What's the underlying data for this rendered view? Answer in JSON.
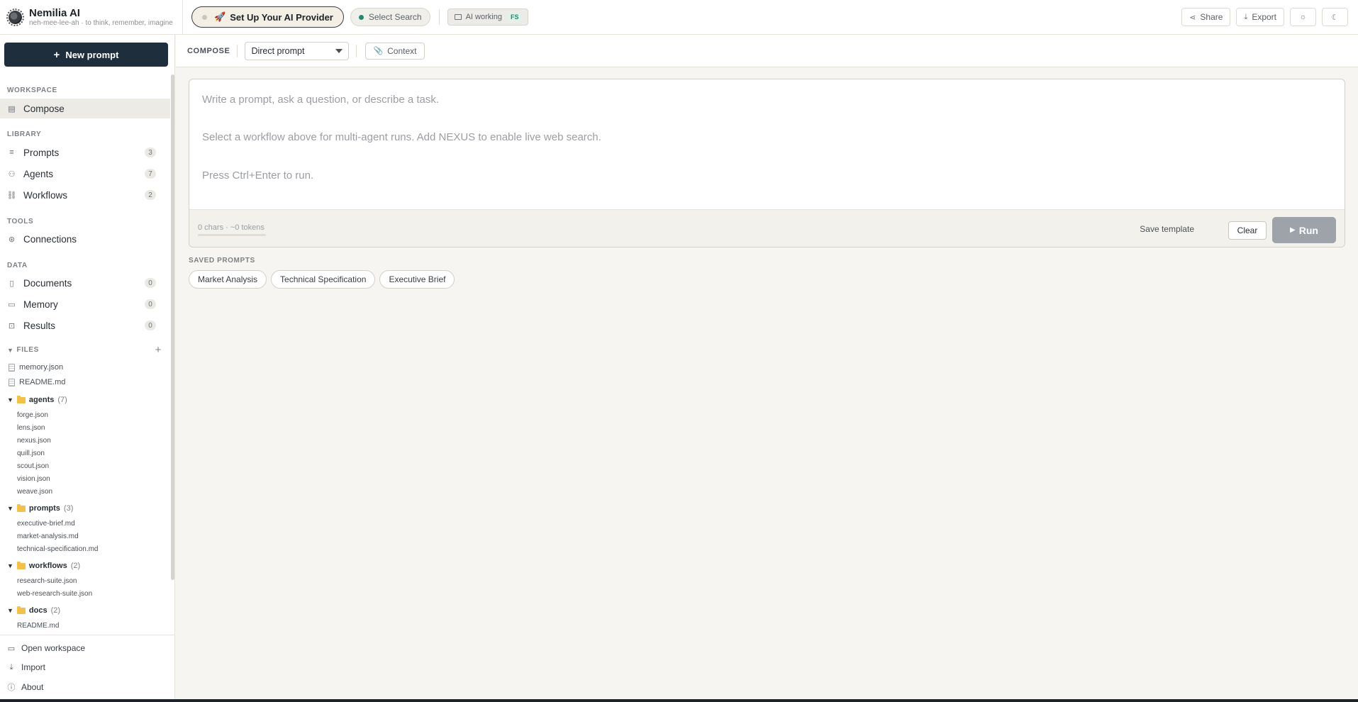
{
  "brand": {
    "name": "Nemilia AI",
    "tagline": "neh-mee-lee-ah · to think, remember, imagine"
  },
  "header": {
    "provider_label": "Set Up Your AI Provider",
    "search_label": "Select Search",
    "folder_label": "AI working",
    "folder_badge": "FS",
    "share_label": "Share",
    "export_label": "Export"
  },
  "sidebar": {
    "new_prompt_label": "New prompt",
    "sections": {
      "workspace": "WORKSPACE",
      "library": "LIBRARY",
      "tools": "TOOLS",
      "data": "DATA",
      "files": "FILES"
    },
    "nav": {
      "compose": "Compose",
      "prompts": {
        "label": "Prompts",
        "count": "3"
      },
      "agents": {
        "label": "Agents",
        "count": "7"
      },
      "workflows": {
        "label": "Workflows",
        "count": "2"
      },
      "connections": "Connections",
      "documents": {
        "label": "Documents",
        "count": "0"
      },
      "memory": {
        "label": "Memory",
        "count": "0"
      },
      "results": {
        "label": "Results",
        "count": "0"
      }
    },
    "files": {
      "root": [
        "memory.json",
        "README.md"
      ],
      "folders": [
        {
          "name": "agents",
          "count": "(7)",
          "children": [
            "forge.json",
            "lens.json",
            "nexus.json",
            "quill.json",
            "scout.json",
            "vision.json",
            "weave.json"
          ]
        },
        {
          "name": "prompts",
          "count": "(3)",
          "children": [
            "executive-brief.md",
            "market-analysis.md",
            "technical-specification.md"
          ]
        },
        {
          "name": "workflows",
          "count": "(2)",
          "children": [
            "research-suite.json",
            "web-research-suite.json"
          ]
        },
        {
          "name": "docs",
          "count": "(2)",
          "children": [
            "README.md"
          ]
        }
      ]
    },
    "footer": {
      "open_workspace": "Open workspace",
      "import": "Import",
      "about": "About"
    }
  },
  "toolbar": {
    "compose_label": "COMPOSE",
    "mode_value": "Direct prompt",
    "context_label": "Context"
  },
  "editor": {
    "placeholder_lines": [
      "Write a prompt, ask a question, or describe a task.",
      "Select a workflow above for multi-agent runs. Add NEXUS to enable live web search.",
      "Press Ctrl+Enter to run."
    ],
    "stats": "0 chars · ~0 tokens",
    "save_template": "Save template",
    "clear": "Clear",
    "run": "Run"
  },
  "saved_prompts": {
    "label": "SAVED PROMPTS",
    "items": [
      "Market Analysis",
      "Technical Specification",
      "Executive Brief"
    ]
  },
  "colors": {
    "primary_dark": "#1e2e3d",
    "accent_green": "#1f8a6e",
    "folder_yellow": "#f1c14b",
    "run_disabled": "#9da3a9"
  }
}
